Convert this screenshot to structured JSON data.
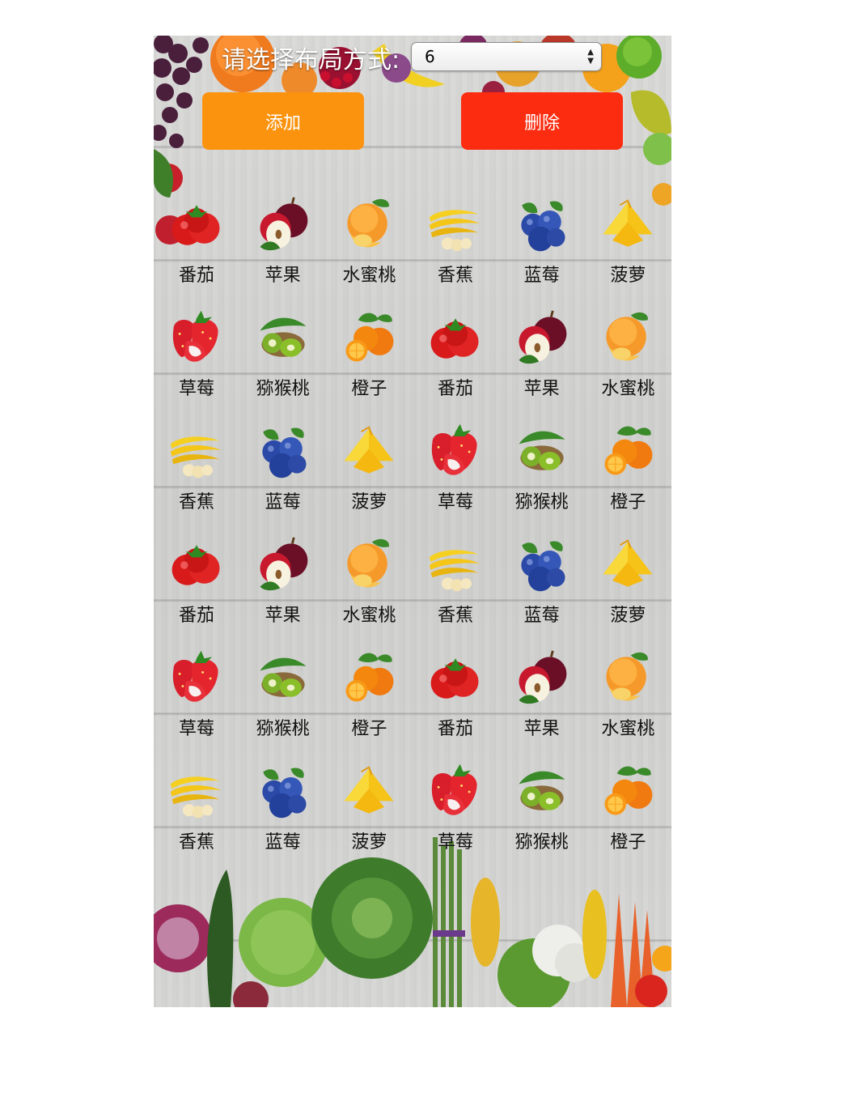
{
  "header": {
    "layout_label": "请选择布局方式:",
    "layout_select_value": "6"
  },
  "actions": {
    "add_label": "添加",
    "delete_label": "删除"
  },
  "colors": {
    "add_button": "#fb930f",
    "delete_button": "#fc2c10"
  },
  "fruits": [
    {
      "label": "番茄",
      "icon": "tomato-icon"
    },
    {
      "label": "苹果",
      "icon": "apple-icon"
    },
    {
      "label": "水蜜桃",
      "icon": "peach-icon"
    },
    {
      "label": "香蕉",
      "icon": "banana-icon"
    },
    {
      "label": "蓝莓",
      "icon": "blueberry-icon"
    },
    {
      "label": "菠萝",
      "icon": "pineapple-icon"
    },
    {
      "label": "草莓",
      "icon": "strawberry-icon"
    },
    {
      "label": "猕猴桃",
      "icon": "kiwi-icon"
    },
    {
      "label": "橙子",
      "icon": "orange-icon"
    },
    {
      "label": "番茄",
      "icon": "tomato-icon"
    },
    {
      "label": "苹果",
      "icon": "apple-icon"
    },
    {
      "label": "水蜜桃",
      "icon": "peach-icon"
    },
    {
      "label": "香蕉",
      "icon": "banana-icon"
    },
    {
      "label": "蓝莓",
      "icon": "blueberry-icon"
    },
    {
      "label": "菠萝",
      "icon": "pineapple-icon"
    },
    {
      "label": "草莓",
      "icon": "strawberry-icon"
    },
    {
      "label": "猕猴桃",
      "icon": "kiwi-icon"
    },
    {
      "label": "橙子",
      "icon": "orange-icon"
    },
    {
      "label": "番茄",
      "icon": "tomato-icon"
    },
    {
      "label": "苹果",
      "icon": "apple-icon"
    },
    {
      "label": "水蜜桃",
      "icon": "peach-icon"
    },
    {
      "label": "香蕉",
      "icon": "banana-icon"
    },
    {
      "label": "蓝莓",
      "icon": "blueberry-icon"
    },
    {
      "label": "菠萝",
      "icon": "pineapple-icon"
    },
    {
      "label": "草莓",
      "icon": "strawberry-icon"
    },
    {
      "label": "猕猴桃",
      "icon": "kiwi-icon"
    },
    {
      "label": "橙子",
      "icon": "orange-icon"
    },
    {
      "label": "番茄",
      "icon": "tomato-icon"
    },
    {
      "label": "苹果",
      "icon": "apple-icon"
    },
    {
      "label": "水蜜桃",
      "icon": "peach-icon"
    },
    {
      "label": "香蕉",
      "icon": "banana-icon"
    },
    {
      "label": "蓝莓",
      "icon": "blueberry-icon"
    },
    {
      "label": "菠萝",
      "icon": "pineapple-icon"
    },
    {
      "label": "草莓",
      "icon": "strawberry-icon"
    },
    {
      "label": "猕猴桃",
      "icon": "kiwi-icon"
    },
    {
      "label": "橙子",
      "icon": "orange-icon"
    }
  ]
}
